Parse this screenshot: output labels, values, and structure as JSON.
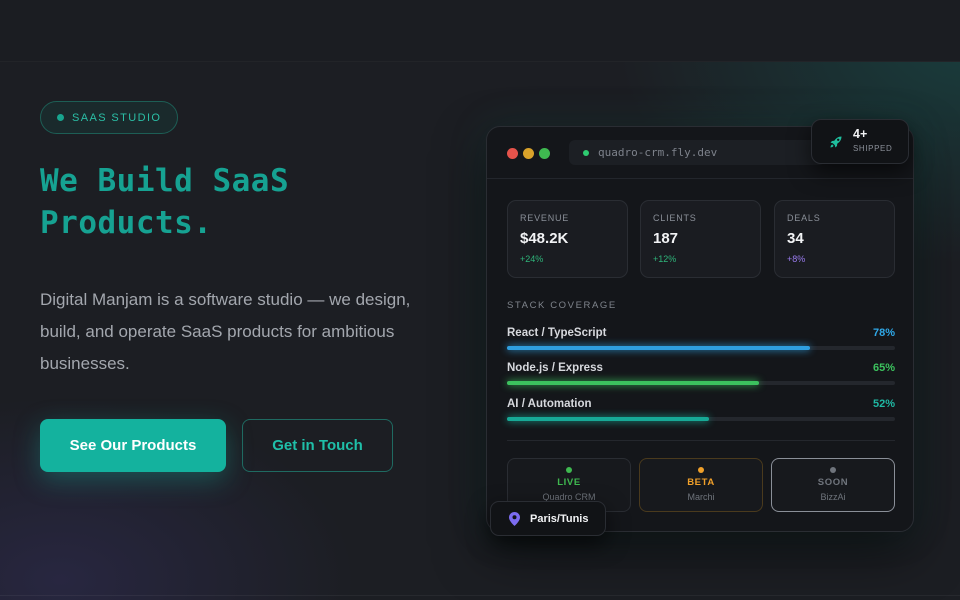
{
  "hero": {
    "badge": "SAAS STUDIO",
    "headline_line1": "We Build SaaS",
    "headline_line2": "Products.",
    "description": "Digital Manjam is a software studio — we design, build, and operate SaaS products for ambitious businesses.",
    "primary_cta": "See Our Products",
    "secondary_cta": "Get in Touch"
  },
  "dashboard": {
    "url": "quadro-crm.fly.dev",
    "stats": [
      {
        "label": "REVENUE",
        "value": "$48.2K",
        "change": "+24%",
        "change_color": "#2fb57a"
      },
      {
        "label": "CLIENTS",
        "value": "187",
        "change": "+12%",
        "change_color": "#2fb57a"
      },
      {
        "label": "DEALS",
        "value": "34",
        "change": "+8%",
        "change_color": "#9b7cf0"
      }
    ],
    "coverage_title": "STACK COVERAGE",
    "coverage": [
      {
        "name": "React / TypeScript",
        "percent_label": "78%",
        "fraction": 0.78,
        "color": "#2f9fe0",
        "label_color": "#2fa8e8"
      },
      {
        "name": "Node.js / Express",
        "percent_label": "65%",
        "fraction": 0.65,
        "color": "#3cc25e",
        "label_color": "#3cc25e"
      },
      {
        "name": "AI / Automation",
        "percent_label": "52%",
        "fraction": 0.52,
        "color": "#17a996",
        "label_color": "#1fb8a3"
      }
    ],
    "products": [
      {
        "status": "LIVE",
        "name": "Quadro CRM",
        "color": "#3fb950",
        "border": "#2a2d33"
      },
      {
        "status": "BETA",
        "name": "Marchi",
        "color": "#f0a02a",
        "border": "#4a3a1d"
      },
      {
        "status": "SOON",
        "name": "BizzAi",
        "color": "#6f747c",
        "border": "#8a8f98"
      }
    ]
  },
  "chips": {
    "shipped_count": "4+",
    "shipped_label": "SHIPPED",
    "location": "Paris/Tunis"
  },
  "colors": {
    "accent": "#14b29e",
    "headline": "#16a292",
    "background": "#1c1e23"
  },
  "icons": {
    "rocket": "rocket-icon",
    "location": "location-pin-icon"
  }
}
